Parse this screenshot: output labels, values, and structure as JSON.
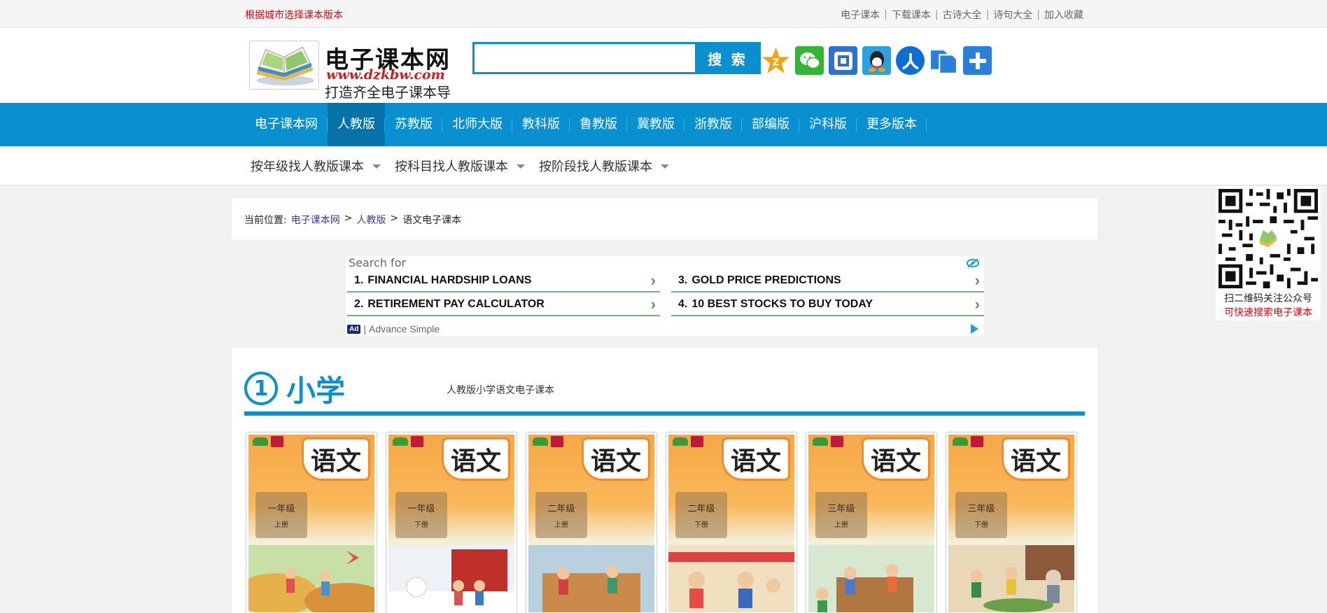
{
  "topbar": {
    "city_link": "根据城市选择课本版本",
    "links": [
      "电子课本",
      "下载课本",
      "古诗大全",
      "诗句大全",
      "加入收藏"
    ]
  },
  "header": {
    "logo_title": "电子课本网",
    "logo_url": "www.dzkbw.com",
    "logo_slogan": "打造齐全电子课本导航",
    "search_placeholder": "",
    "search_button": "搜 索",
    "share_icons": [
      "qzone-icon",
      "wechat-icon",
      "tieba-icon",
      "qq-icon",
      "renren-icon",
      "copy-icon",
      "more-share-icon"
    ]
  },
  "mainnav": {
    "items": [
      "电子课本网",
      "人教版",
      "苏教版",
      "北师大版",
      "教科版",
      "鲁教版",
      "冀教版",
      "浙教版",
      "部编版",
      "沪科版",
      "更多版本"
    ],
    "active_index": 1
  },
  "subnav": {
    "items": [
      "按年级找人教版课本",
      "按科目找人教版课本",
      "按阶段找人教版课本"
    ]
  },
  "breadcrumb": {
    "label": "当前位置:",
    "home": "电子课本网",
    "sep1": ">",
    "edition": "人教版",
    "sep2": ">",
    "current": "语文电子课本"
  },
  "ad": {
    "search_for": "Search for",
    "items": [
      {
        "num": "1.",
        "text": "FINANCIAL HARDSHIP LOANS"
      },
      {
        "num": "2.",
        "text": "RETIREMENT PAY CALCULATOR"
      },
      {
        "num": "3.",
        "text": "GOLD PRICE PREDICTIONS"
      },
      {
        "num": "4.",
        "text": "10 BEST STOCKS TO BUY TODAY"
      }
    ],
    "badge": "Ad",
    "sponsor": "Advance Simple"
  },
  "section": {
    "number": "1",
    "title": "小学",
    "subtitle": "人教版小学语文电子课本",
    "books": [
      {
        "subject": "语文",
        "grade": "一年级",
        "volume": "上册"
      },
      {
        "subject": "语文",
        "grade": "一年级",
        "volume": "下册"
      },
      {
        "subject": "语文",
        "grade": "二年级",
        "volume": "上册"
      },
      {
        "subject": "语文",
        "grade": "二年级",
        "volume": "下册"
      },
      {
        "subject": "语文",
        "grade": "三年级",
        "volume": "上册"
      },
      {
        "subject": "语文",
        "grade": "三年级",
        "volume": "下册"
      }
    ]
  },
  "qr": {
    "line1": "扫二维码关注公众号",
    "line2": "可快速搜索电子课本"
  },
  "colors": {
    "brand_blue": "#0a8fd0",
    "active_nav": "#0672a8",
    "red": "#e60012"
  }
}
